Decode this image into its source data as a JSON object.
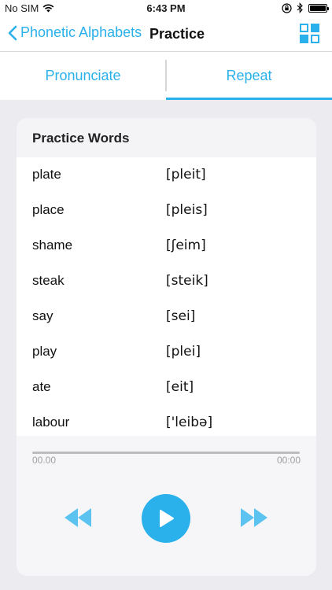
{
  "status_bar": {
    "carrier": "No SIM",
    "time": "6:43 PM"
  },
  "nav": {
    "back_label": "Phonetic Alphabets",
    "title": "Practice"
  },
  "tabs": [
    {
      "label": "Pronunciate",
      "selected": false
    },
    {
      "label": "Repeat",
      "selected": true
    }
  ],
  "card": {
    "title": "Practice Words",
    "words": [
      {
        "word": "plate",
        "phonetic": "[pleit]"
      },
      {
        "word": "place",
        "phonetic": "[pleis]"
      },
      {
        "word": "shame",
        "phonetic": "[ʃeim]"
      },
      {
        "word": "steak",
        "phonetic": "[steik]"
      },
      {
        "word": "say",
        "phonetic": "[sei]"
      },
      {
        "word": "play",
        "phonetic": "[plei]"
      },
      {
        "word": "ate",
        "phonetic": "[eit]"
      },
      {
        "word": "labour",
        "phonetic": "['leibə]"
      }
    ]
  },
  "player": {
    "current_time": "00.00",
    "total_time": "00:00",
    "progress": 0
  },
  "colors": {
    "accent": "#2ab0ea",
    "background": "#ebebf0",
    "card": "#f6f6f8"
  },
  "icons": [
    "wifi-icon",
    "lock-rotation-icon",
    "bluetooth-icon",
    "battery-icon",
    "back-chevron-icon",
    "grid-icon",
    "rewind-icon",
    "play-icon",
    "fast-forward-icon"
  ]
}
